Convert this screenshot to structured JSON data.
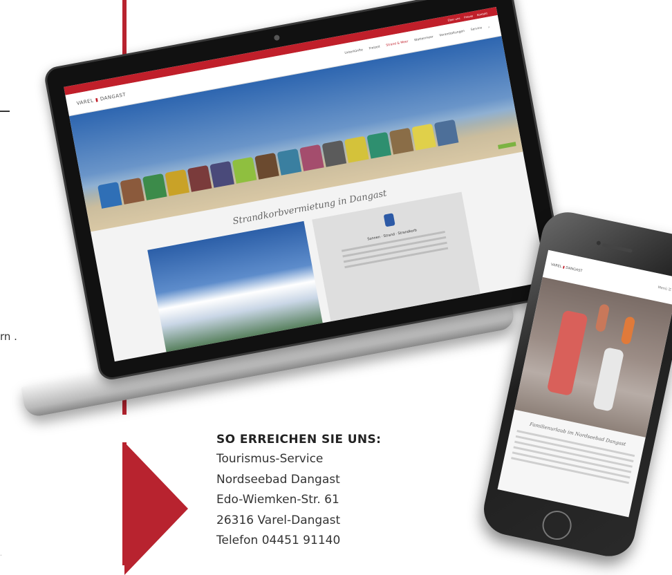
{
  "contact": {
    "title": "SO ERREICHEN SIE UNS:",
    "lines": [
      "Tourismus-Service",
      "Nordseebad Dangast",
      "Edo-Wiemken-Str. 61",
      "26316 Varel-Dangast",
      "Telefon 04451 91140"
    ]
  },
  "stray_text": "rn .",
  "laptop_site": {
    "logo_left": "VAREL",
    "logo_right": "DANGAST",
    "topbar_items": [
      "Über uns",
      "Presse",
      "Kontakt"
    ],
    "nav": [
      "Unterkünfte",
      "Freizeit",
      "Strand & Meer",
      "Wattenmeer",
      "Veranstaltungen",
      "Service"
    ],
    "active_nav_index": 2,
    "section_title": "Strandkorbvermietung in Dangast",
    "card_title": "Sonnen · Strand · Strandkorb"
  },
  "phone_site": {
    "logo_left": "VAREL",
    "logo_right": "DANGAST",
    "menu_label": "Menü ☰",
    "section_title": "Familienurlaub im Nordseebad Dangast"
  },
  "colors": {
    "accent_red": "#b8232f",
    "site_red": "#c01f2a"
  }
}
